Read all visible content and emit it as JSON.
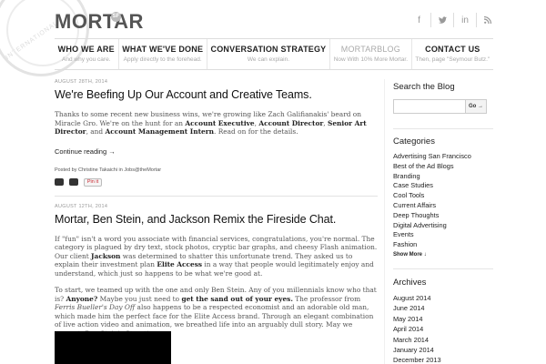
{
  "seal": {
    "text": "INTERNATIONAL"
  },
  "brand": {
    "logo": "MORTAR",
    "badge": "SF"
  },
  "social": [
    {
      "icon": "facebook-icon",
      "glyph": "f"
    },
    {
      "icon": "twitter-icon",
      "glyph": "✉"
    },
    {
      "icon": "linkedin-icon",
      "glyph": "in"
    },
    {
      "icon": "rss-icon",
      "glyph": "∷"
    }
  ],
  "nav": [
    {
      "title": "WHO WE ARE",
      "sub": "And why you care."
    },
    {
      "title": "WHAT WE'VE DONE",
      "sub": "Apply directly to the forehead."
    },
    {
      "title": "CONVERSATION STRATEGY",
      "sub": "We can explain."
    },
    {
      "title": "MORTARBLOG",
      "sub": "Now With 10% More Mortar."
    },
    {
      "title": "CONTACT US",
      "sub": "Then, page \"Seymour Butz.\""
    }
  ],
  "post1": {
    "date": "AUGUST 28TH, 2014",
    "title": "We're Beefing Up Our Account and Creative Teams.",
    "body_a": "Thanks to some recent new business wins, we're growing like Zach Galifianakis' beard on Miracle Gro. We're on the hunt for an ",
    "role1": "Account Executive",
    "c1": ", ",
    "role2": "Account Director",
    "c2": ", ",
    "role3": "Senior Art Director",
    "c3": ", and ",
    "role4": "Account Management Intern",
    "body_b": ". Read on for the details.",
    "continue": "Continue reading →",
    "posted_prefix": "Posted by",
    "author": "Christine Takaichi",
    "posted_in": "in",
    "category": "Jobs@theMortar",
    "share_a": "",
    "share_b": "",
    "pin": "Pin it"
  },
  "post2": {
    "date": "AUGUST 12TH, 2014",
    "title": "Mortar, Ben Stein, and Jackson Remix the Fireside Chat.",
    "p1_a": "If \"fun\" isn't a word you associate with financial services, congratulations, you're normal. The category is plagued by dry text, stock photos, cryptic bar graphs, and cheesy Flash animation. Our client ",
    "client": "Jackson",
    "p1_b": " was determined to shatter this unfortunate trend. They asked us to explain their investment plan ",
    "plan": "Elite Access",
    "p1_c": " in a way that people would legitimately enjoy and understand, which just so happens to be what we're good at.",
    "p2_a": "To start, we teamed up with the one and only Ben Stein. Any of you millennials know who that is? ",
    "anyone": "Anyone?",
    "p2_b": " Maybe you just need to ",
    "sand": "get the sand out of your eyes.",
    "p2_c": " The professor from ",
    "film": "Ferris Bueller's Day Off",
    "p2_d": " also happens to be a respected economist and an adorable old man, which made him the perfect face for the Elite Access brand.  Through an elegant combination of live action video and animation, we breathed life into an arguably dull story. May we present, Ben Stein's Storytime."
  },
  "sidebar": {
    "search_title": "Search the Blog",
    "search_button": "Go →",
    "search_value": "",
    "categories_title": "Categories",
    "categories": [
      "Advertising San Francisco",
      "Best of the Ad Blogs",
      "Branding",
      "Case Studies",
      "Cool Tools",
      "Current Affairs",
      "Deep Thoughts",
      "Digital Advertising",
      "Events",
      "Fashion"
    ],
    "show_more": "Show More  ↓",
    "archives_title": "Archives",
    "archives": [
      "August 2014",
      "June 2014",
      "May 2014",
      "April 2014",
      "March 2014",
      "January 2014",
      "December 2013"
    ]
  }
}
